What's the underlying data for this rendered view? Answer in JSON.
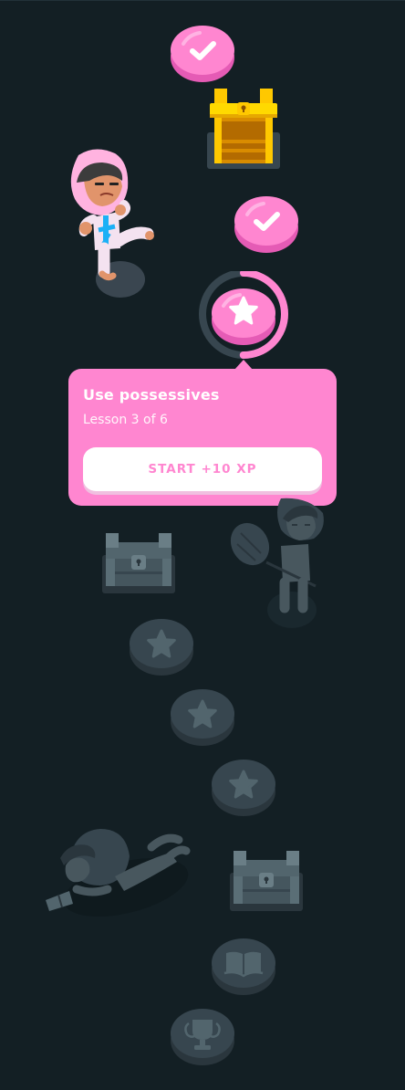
{
  "popup": {
    "title": "Use possessives",
    "subtitle": "Lesson 3 of 6",
    "button_label": "START +10 XP"
  },
  "current_lesson_progress": 0.5,
  "path_nodes": [
    {
      "type": "lesson",
      "state": "completed",
      "icon": "check-icon"
    },
    {
      "type": "chest",
      "state": "opened",
      "icon": "treasure-chest-icon"
    },
    {
      "type": "lesson",
      "state": "completed",
      "icon": "check-icon"
    },
    {
      "type": "lesson",
      "state": "current",
      "icon": "star-icon"
    },
    {
      "type": "chest",
      "state": "locked",
      "icon": "treasure-chest-icon"
    },
    {
      "type": "lesson",
      "state": "locked",
      "icon": "star-icon"
    },
    {
      "type": "lesson",
      "state": "locked",
      "icon": "star-icon"
    },
    {
      "type": "lesson",
      "state": "locked",
      "icon": "star-icon"
    },
    {
      "type": "chest",
      "state": "locked",
      "icon": "treasure-chest-icon"
    },
    {
      "type": "story",
      "state": "locked",
      "icon": "book-icon"
    },
    {
      "type": "unit-review",
      "state": "locked",
      "icon": "trophy-icon"
    }
  ],
  "colors": {
    "background": "#131f24",
    "accent": "#ff86d0",
    "accent_dark": "#e55bb5",
    "locked": "#37464f",
    "locked_dark": "#2a363d",
    "locked_icon": "#52656d",
    "chest_gold": "#ffc800"
  }
}
